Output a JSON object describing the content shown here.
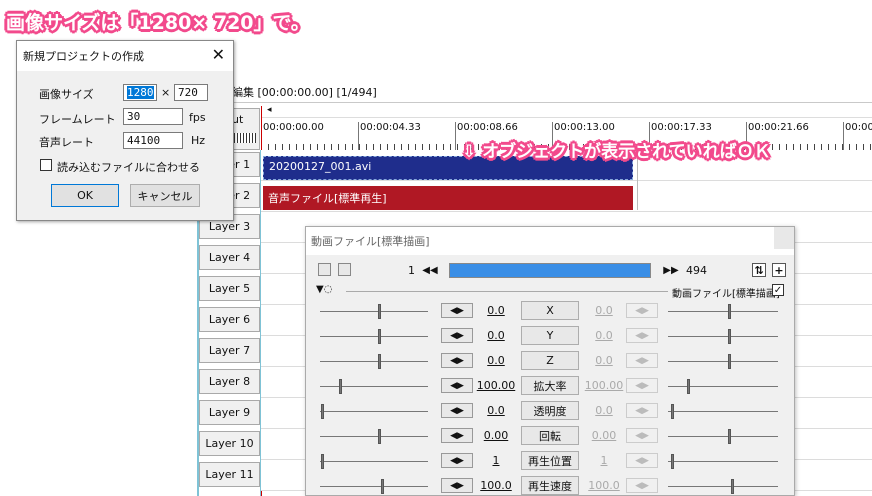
{
  "annotation_top": "画像サイズは「1280× 720」で。",
  "annotation_mid": "⇩ オブジェクトが表示されていればＯＫ",
  "timeline": {
    "title": "編集 [00:00:00.00] [1/494]",
    "layer_partial": "ut",
    "times": [
      "00:00:00.00",
      "00:00:04.33",
      "00:00:08.66",
      "00:00:13.00",
      "00:00:17.33",
      "00:00:21.66",
      "00:00"
    ],
    "layers": [
      "Layer 1",
      "Layer 2",
      "Layer 3",
      "Layer 4",
      "Layer 5",
      "Layer 6",
      "Layer 7",
      "Layer 8",
      "Layer 9",
      "Layer 10",
      "Layer 11"
    ],
    "layer_partials": [
      "r 1",
      "r 2"
    ],
    "objects": [
      {
        "label": "20200127_001.avi",
        "color": "#1f2d8c"
      },
      {
        "label": "音声ファイル[標準再生]",
        "color": "#b01824"
      }
    ]
  },
  "dialog": {
    "title": "新規プロジェクトの作成",
    "size_label": "画像サイズ",
    "width": "1280",
    "times": "×",
    "height": "720",
    "framerate_label": "フレームレート",
    "framerate": "30",
    "fps": "fps",
    "audio_label": "音声レート",
    "audio": "44100",
    "hz": "Hz",
    "check_label": "読み込むファイルに合わせる",
    "ok": "OK",
    "cancel": "キャンセル"
  },
  "props": {
    "title": "動画ファイル[標準描画]",
    "frame_start": "1",
    "frame_end": "494",
    "filter_label": "動画ファイル[標準描画]",
    "rows": [
      {
        "name": "X",
        "left": "0.0",
        "right": "0.0"
      },
      {
        "name": "Y",
        "left": "0.0",
        "right": "0.0"
      },
      {
        "name": "Z",
        "left": "0.0",
        "right": "0.0"
      },
      {
        "name": "拡大率",
        "left": "100.00",
        "right": "100.00"
      },
      {
        "name": "透明度",
        "left": "0.0",
        "right": "0.0"
      },
      {
        "name": "回転",
        "left": "0.00",
        "right": "0.00"
      },
      {
        "name": "再生位置",
        "left": "1",
        "right": "1"
      },
      {
        "name": "再生速度",
        "left": "100.0",
        "right": "100.0"
      }
    ]
  }
}
